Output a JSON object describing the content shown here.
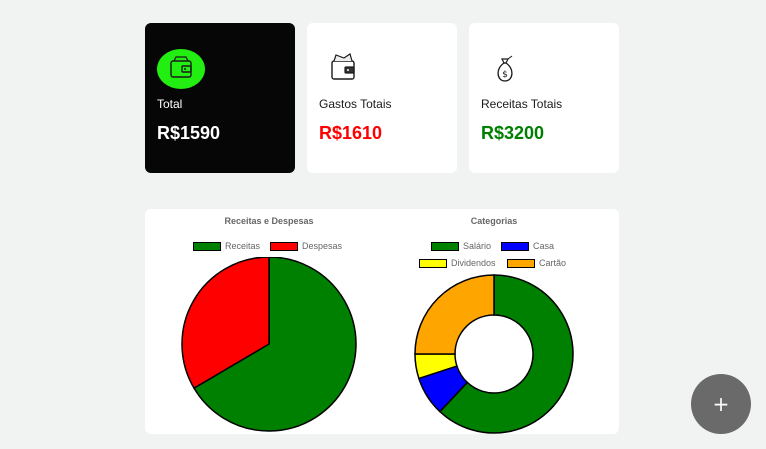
{
  "cards": [
    {
      "label": "Total",
      "value": "R$1590",
      "value_color": "#ffffff",
      "icon": "wallet-icon"
    },
    {
      "label": "Gastos Totais",
      "value": "R$1610",
      "value_color": "#ff0000",
      "icon": "wallet-cash-icon"
    },
    {
      "label": "Receitas Totais",
      "value": "R$3200",
      "value_color": "#008000",
      "icon": "money-bag-icon"
    }
  ],
  "chart_data": [
    {
      "type": "pie",
      "title": "Receitas e Despesas",
      "labels": [
        "Receitas",
        "Despesas"
      ],
      "values": [
        3200,
        1610
      ],
      "colors": [
        "#008000",
        "#ff0000"
      ]
    },
    {
      "type": "doughnut",
      "title": "Categorias",
      "labels": [
        "Salário",
        "Casa",
        "Dividendos",
        "Cartão"
      ],
      "values": [
        62,
        8,
        5,
        25
      ],
      "colors": [
        "#008000",
        "#0000ff",
        "#ffff00",
        "#ffa500"
      ]
    }
  ],
  "fab": {
    "label": "+",
    "icon": "plus-icon"
  }
}
